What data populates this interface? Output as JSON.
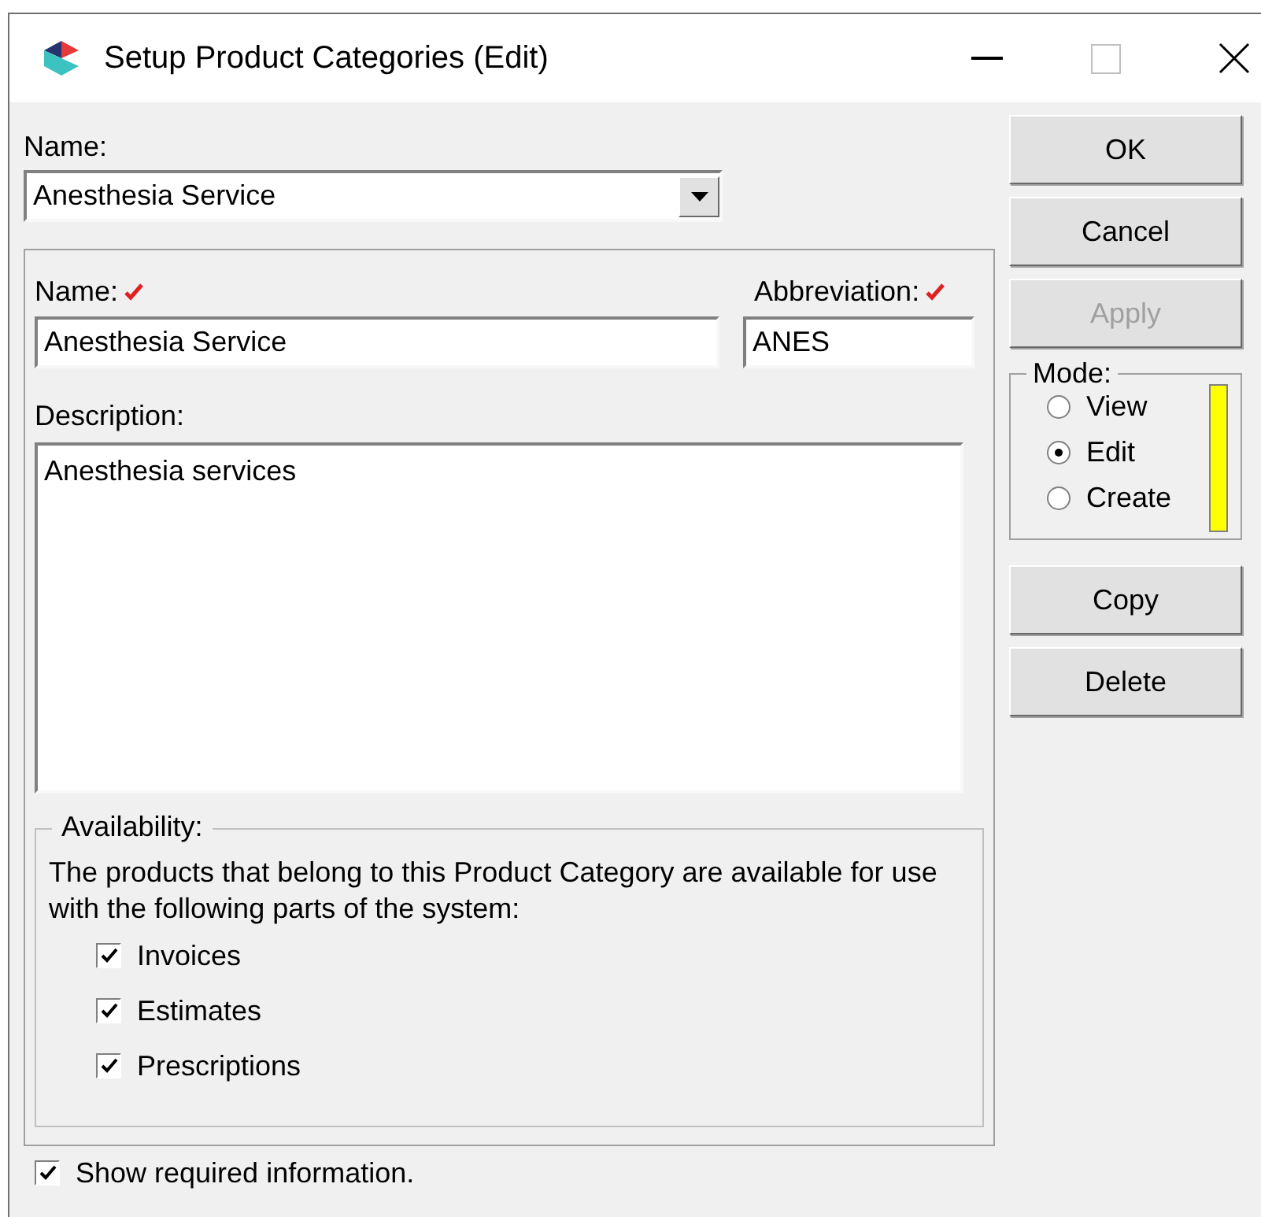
{
  "window": {
    "title": "Setup Product Categories (Edit)"
  },
  "selector": {
    "label": "Name:",
    "value": "Anesthesia Service"
  },
  "fields": {
    "name": {
      "label": "Name:",
      "required": true,
      "value": "Anesthesia Service"
    },
    "abbreviation": {
      "label": "Abbreviation:",
      "required": true,
      "value": "ANES"
    },
    "description": {
      "label": "Description:",
      "value": "Anesthesia services"
    }
  },
  "availability": {
    "title": "Availability:",
    "text": "The products that belong to this Product Category are available for use with the following parts of the system:",
    "options": [
      {
        "label": "Invoices",
        "checked": true
      },
      {
        "label": "Estimates",
        "checked": true
      },
      {
        "label": "Prescriptions",
        "checked": true
      }
    ]
  },
  "show_required": {
    "label": "Show required information.",
    "checked": true
  },
  "buttons_top": [
    {
      "label": "OK",
      "disabled": false
    },
    {
      "label": "Cancel",
      "disabled": false
    },
    {
      "label": "Apply",
      "disabled": true
    }
  ],
  "mode": {
    "title": "Mode:",
    "options": [
      {
        "label": "View",
        "selected": false
      },
      {
        "label": "Edit",
        "selected": true
      },
      {
        "label": "Create",
        "selected": false
      }
    ]
  },
  "buttons_bottom": [
    {
      "label": "Copy",
      "disabled": false
    },
    {
      "label": "Delete",
      "disabled": false
    }
  ]
}
